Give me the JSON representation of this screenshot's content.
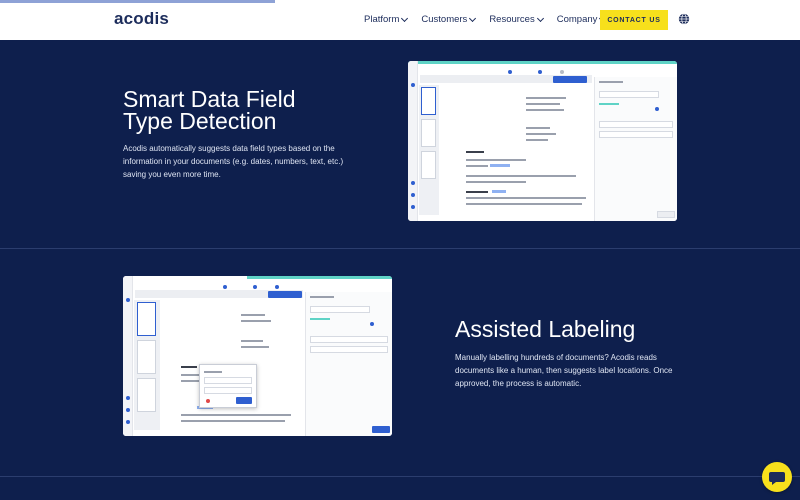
{
  "header": {
    "logo": "acodis",
    "nav": [
      {
        "label": "Platform"
      },
      {
        "label": "Customers"
      },
      {
        "label": "Resources"
      },
      {
        "label": "Company"
      }
    ],
    "cta_label": "CONTACT US",
    "globe_icon": "globe-icon"
  },
  "sections": [
    {
      "title_line1": "Smart Data Field",
      "title_line2": "Type Detection",
      "desc_line1": "Acodis automatically suggests data field types based on the",
      "desc_line2": "information in your documents (e.g. dates, numbers, text, etc.)",
      "desc_line3": "saving you even more time."
    },
    {
      "title_line1": "Assisted Labeling",
      "desc_line1": "Manually labelling hundreds of documents? Acodis reads",
      "desc_line2": "documents like a human, then suggests label locations. Once",
      "desc_line3": "approved, the process is automatic."
    }
  ],
  "colors": {
    "background": "#0e1f4d",
    "accent_yellow": "#f7e01c",
    "accent_blue": "#2f5fd0",
    "accent_teal": "#5fd3c6"
  },
  "chat_icon": "chat-bubble-icon"
}
